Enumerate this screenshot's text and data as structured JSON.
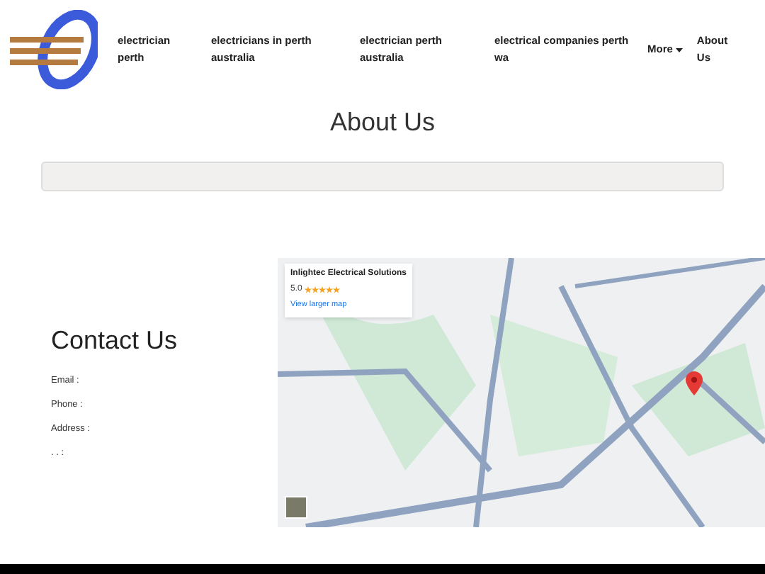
{
  "nav": {
    "items": [
      {
        "label": "electrician perth"
      },
      {
        "label": "electricians in perth australia"
      },
      {
        "label": "electrician perth australia"
      },
      {
        "label": "electrical companies perth wa"
      }
    ],
    "more": "More",
    "about": "About Us"
  },
  "page_title": "About Us",
  "contact": {
    "title": "Contact Us",
    "lines": [
      "Email :",
      "Phone :",
      "Address :",
      ". . :"
    ]
  },
  "map": {
    "business": "Inlightec Electrical Solutions",
    "rating": "5.0",
    "stars": 5,
    "link": "View larger map"
  }
}
